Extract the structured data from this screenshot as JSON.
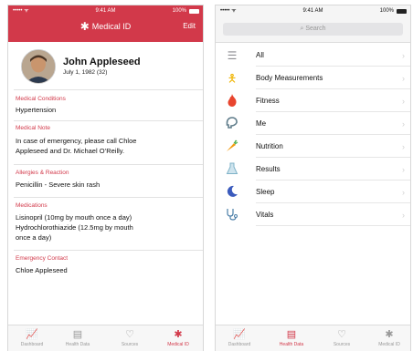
{
  "left": {
    "status": {
      "carrier": "••••• ᯤ",
      "time": "9:41 AM",
      "battery": "100%"
    },
    "nav": {
      "title": "Medical ID",
      "edit": "Edit"
    },
    "profile": {
      "name": "John Appleseed",
      "dob": "July 1, 1982 (32)"
    },
    "sections": [
      {
        "label": "Medical Conditions",
        "lines": [
          "Hypertension"
        ]
      },
      {
        "label": "Medical Note",
        "lines": [
          "In case of emergency, please call Chloe",
          "Appleseed and Dr. Michael O’Reilly."
        ]
      },
      {
        "label": "Allergies & Reaction",
        "lines": [
          "Penicillin - Severe skin rash"
        ]
      },
      {
        "label": "Medications",
        "lines": [
          "Lisinopril (10mg by mouth once a day)",
          "Hydrochlorothiazide (12.5mg by mouth",
          "once a day)"
        ]
      },
      {
        "label": "Emergency Contact",
        "lines": [
          "Chloe Appleseed"
        ]
      }
    ],
    "tabs": [
      {
        "label": "Dashboard",
        "icon": "chart-icon"
      },
      {
        "label": "Health Data",
        "icon": "folder-icon"
      },
      {
        "label": "Sources",
        "icon": "heart-icon"
      },
      {
        "label": "Medical ID",
        "icon": "asterisk-icon"
      }
    ]
  },
  "right": {
    "status": {
      "carrier": "••••• ᯤ",
      "time": "9:41 AM",
      "battery": "100%"
    },
    "search": {
      "placeholder": "Search"
    },
    "categories": [
      {
        "label": "All",
        "icon": "list-icon",
        "color": "#8e8e93"
      },
      {
        "label": "Body Measurements",
        "icon": "person-icon",
        "color": "#f0b400"
      },
      {
        "label": "Fitness",
        "icon": "flame-icon",
        "color": "#e8452e"
      },
      {
        "label": "Me",
        "icon": "head-icon",
        "color": "#607d8b"
      },
      {
        "label": "Nutrition",
        "icon": "carrot-icon",
        "color": "#f39c12"
      },
      {
        "label": "Results",
        "icon": "flask-icon",
        "color": "#7fb3c8"
      },
      {
        "label": "Sleep",
        "icon": "moon-icon",
        "color": "#3b5bbd"
      },
      {
        "label": "Vitals",
        "icon": "stethoscope-icon",
        "color": "#4a7ea8"
      }
    ],
    "tabs": [
      {
        "label": "Dashboard",
        "icon": "chart-icon"
      },
      {
        "label": "Health Data",
        "icon": "folder-icon"
      },
      {
        "label": "Sources",
        "icon": "heart-icon"
      },
      {
        "label": "Medical ID",
        "icon": "asterisk-icon"
      }
    ]
  },
  "colors": {
    "accent": "#d2394a"
  }
}
